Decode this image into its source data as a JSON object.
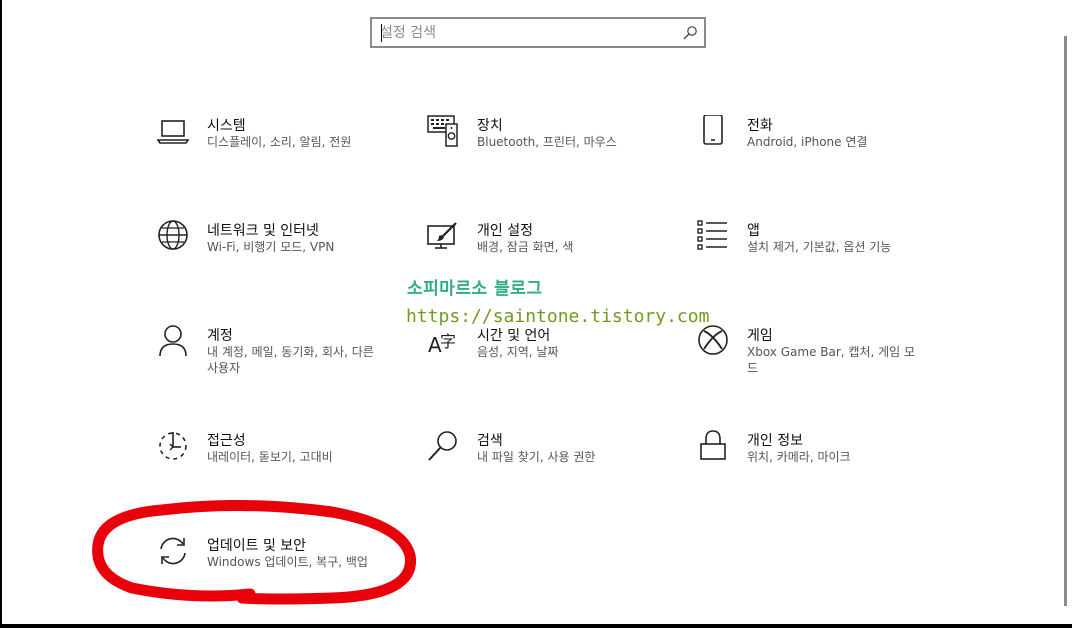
{
  "search": {
    "placeholder": "설정 검색"
  },
  "tiles": [
    {
      "id": "system",
      "title": "시스템",
      "desc": "디스플레이, 소리, 알림, 전원",
      "icon": "laptop-icon"
    },
    {
      "id": "devices",
      "title": "장치",
      "desc": "Bluetooth, 프린터, 마우스",
      "icon": "devices-icon"
    },
    {
      "id": "phone",
      "title": "전화",
      "desc": "Android, iPhone 연결",
      "icon": "phone-icon"
    },
    {
      "id": "network",
      "title": "네트워크 및 인터넷",
      "desc": "Wi-Fi, 비행기 모드, VPN",
      "icon": "globe-icon"
    },
    {
      "id": "personalization",
      "title": "개인 설정",
      "desc": "배경, 잠금 화면, 색",
      "icon": "paintbrush-icon"
    },
    {
      "id": "apps",
      "title": "앱",
      "desc": "설치 제거, 기본값, 옵션 기능",
      "icon": "apps-list-icon"
    },
    {
      "id": "accounts",
      "title": "계정",
      "desc": "내 계정, 메일, 동기화, 회사, 다른 사용자",
      "icon": "person-icon"
    },
    {
      "id": "time-language",
      "title": "시간 및 언어",
      "desc": "음성, 지역, 날짜",
      "icon": "language-icon"
    },
    {
      "id": "gaming",
      "title": "게임",
      "desc": "Xbox Game Bar, 캡처, 게임 모드",
      "icon": "xbox-icon"
    },
    {
      "id": "accessibility",
      "title": "접근성",
      "desc": "내레이터, 돋보기, 고대비",
      "icon": "accessibility-icon"
    },
    {
      "id": "search",
      "title": "검색",
      "desc": "내 파일 찾기, 사용 권한",
      "icon": "magnifier-icon"
    },
    {
      "id": "privacy",
      "title": "개인 정보",
      "desc": "위치, 카메라, 마이크",
      "icon": "lock-icon"
    },
    {
      "id": "update-security",
      "title": "업데이트 및 보안",
      "desc": "Windows 업데이트, 복구, 백업",
      "icon": "sync-icon"
    }
  ],
  "watermark": {
    "line1": "소피마르소 블로그",
    "line2": "https://saintone.tistory.com"
  },
  "colors": {
    "accent_red": "#e8000b",
    "watermark_green": "#2fae80",
    "url_green": "#6f9b1e"
  }
}
